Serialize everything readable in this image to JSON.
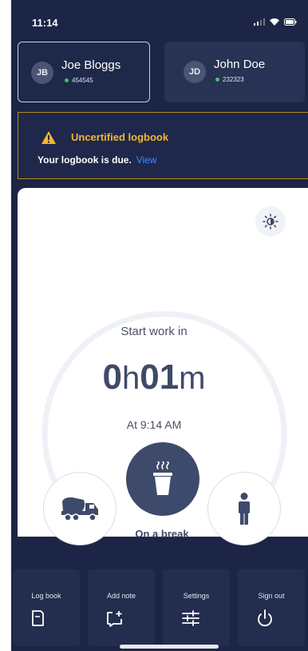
{
  "status_bar": {
    "time": "11:14"
  },
  "drivers": [
    {
      "initials": "JB",
      "name": "Joe Bloggs",
      "id": "454545",
      "selected": true
    },
    {
      "initials": "JD",
      "name": "John Doe",
      "id": "232323",
      "selected": false
    }
  ],
  "alert": {
    "title": "Uncertified logbook",
    "message": "Your logbook is due.",
    "link": "View"
  },
  "timer": {
    "label": "Start work in",
    "hours": "0",
    "hours_unit": "h",
    "minutes": "01",
    "minutes_unit": "m",
    "at_time": "At 9:14 AM"
  },
  "activities": {
    "left_icon": "truck-icon",
    "center_icon": "coffee-cup-icon",
    "right_icon": "person-icon",
    "selected_label": "On a break"
  },
  "nav": [
    {
      "label": "Log book",
      "icon": "logbook-icon"
    },
    {
      "label": "Add note",
      "icon": "add-note-icon"
    },
    {
      "label": "Settings",
      "icon": "settings-sliders-icon"
    },
    {
      "label": "Sign out",
      "icon": "power-icon"
    }
  ],
  "colors": {
    "background": "#1c2545",
    "warning": "#f2b632",
    "link": "#3a8dff",
    "status_dot": "#3ec46d",
    "active_activity": "#3d4a6b"
  }
}
